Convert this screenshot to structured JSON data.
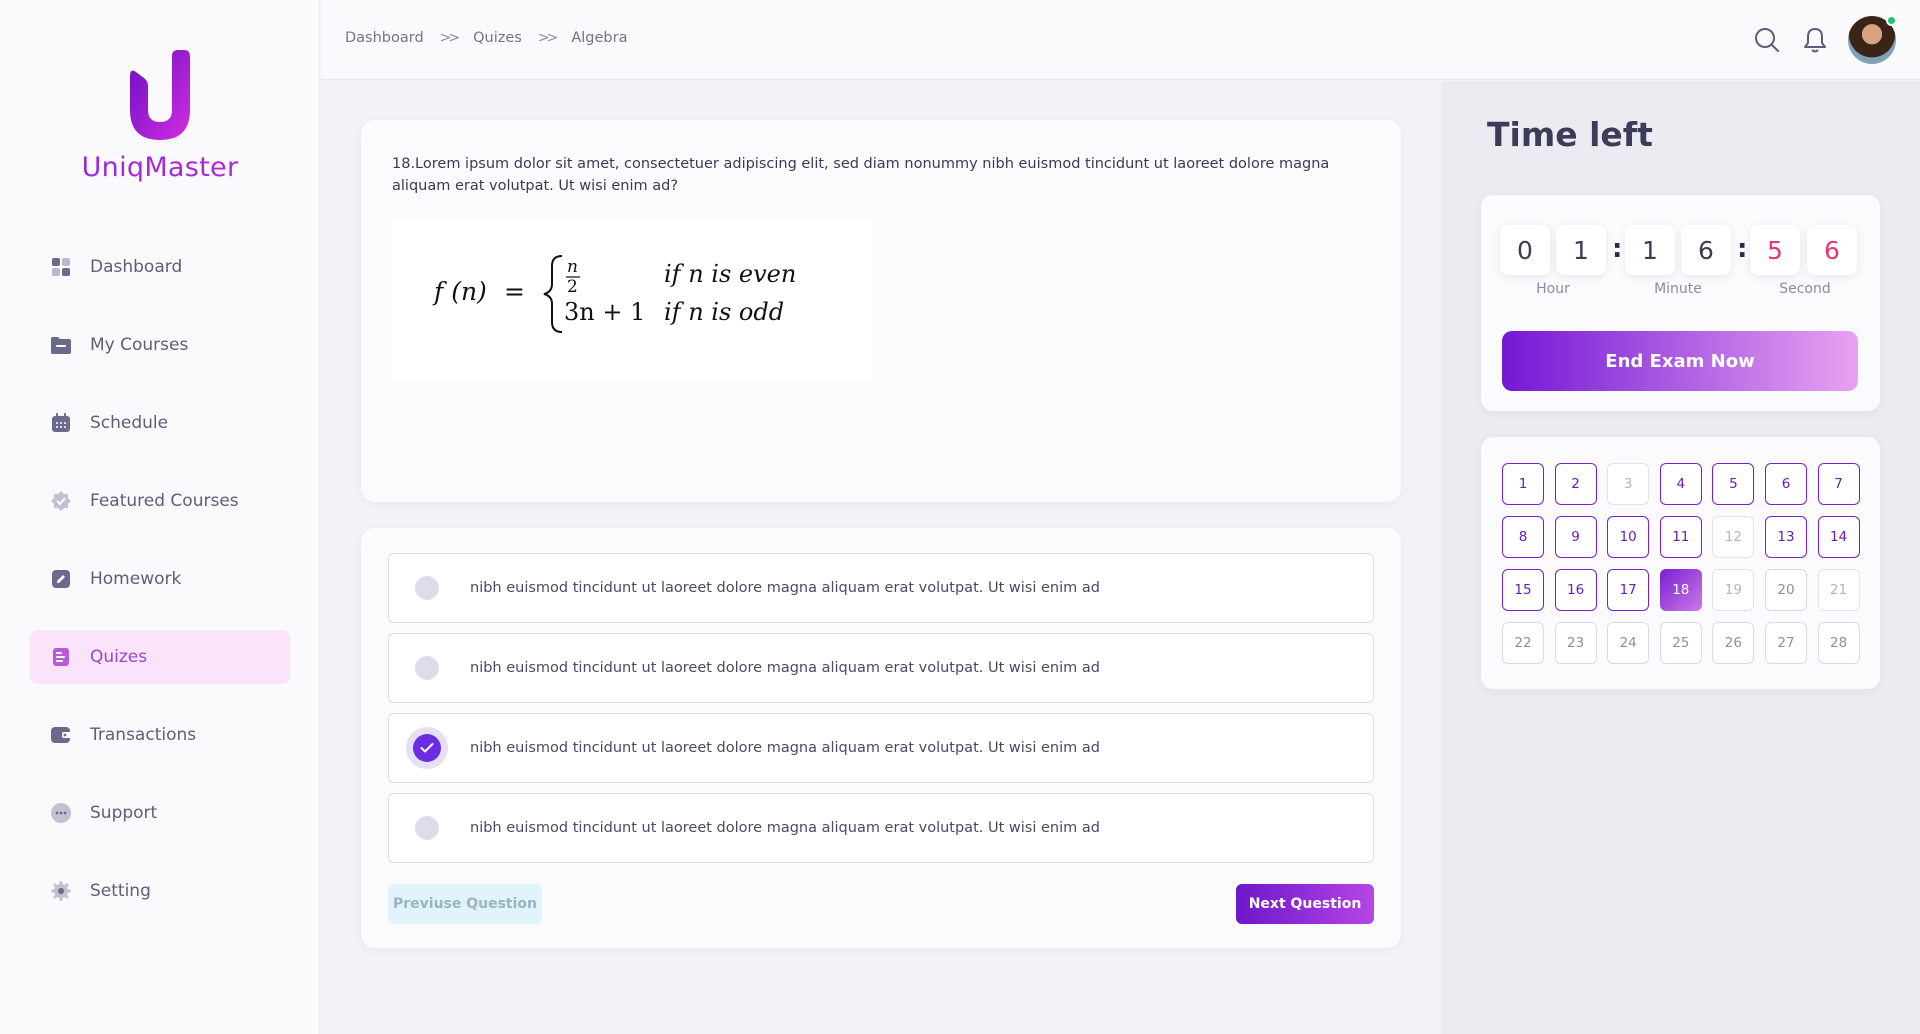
{
  "app": {
    "name": "UniqMaster"
  },
  "sidebar": {
    "items": [
      {
        "label": "Dashboard",
        "icon": "dashboard-icon",
        "active": false
      },
      {
        "label": "My Courses",
        "icon": "folder-icon",
        "active": false
      },
      {
        "label": "Schedule",
        "icon": "calendar-icon",
        "active": false
      },
      {
        "label": "Featured Courses",
        "icon": "badge-icon",
        "active": false
      },
      {
        "label": "Homework",
        "icon": "edit-icon",
        "active": false
      },
      {
        "label": "Quizes",
        "icon": "document-icon",
        "active": true
      },
      {
        "label": "Transactions",
        "icon": "wallet-icon",
        "active": false
      },
      {
        "label": "Support",
        "icon": "chat-icon",
        "active": false
      },
      {
        "label": "Setting",
        "icon": "gear-icon",
        "active": false
      }
    ]
  },
  "breadcrumb": [
    "Dashboard",
    "Quizes",
    "Algebra"
  ],
  "header": {
    "icons": [
      "search-icon",
      "bell-icon"
    ],
    "online_status_color": "#1ec77a"
  },
  "question": {
    "text": "18.Lorem ipsum dolor sit amet, consectetuer adipiscing elit, sed diam nonummy nibh euismod tincidunt ut laoreet dolore magna aliquam erat volutpat. Ut wisi enim ad?",
    "formula": {
      "lhs": "f (n)",
      "eq": "=",
      "case1_value_num": "n",
      "case1_value_den": "2",
      "case1_condition": "if n is even",
      "case2_value": "3n + 1",
      "case2_condition": "if n is odd"
    }
  },
  "answers": [
    {
      "text": "nibh euismod tincidunt ut laoreet dolore magna aliquam erat volutpat. Ut wisi enim ad",
      "selected": false
    },
    {
      "text": "nibh euismod tincidunt ut laoreet dolore magna aliquam erat volutpat. Ut wisi enim ad",
      "selected": false
    },
    {
      "text": "nibh euismod tincidunt ut laoreet dolore magna aliquam erat volutpat. Ut wisi enim ad",
      "selected": true
    },
    {
      "text": "nibh euismod tincidunt ut laoreet dolore magna aliquam erat volutpat. Ut wisi enim ad",
      "selected": false
    }
  ],
  "nav_buttons": {
    "prev": "Previuse Question",
    "next": "Next Question"
  },
  "timer": {
    "title": "Time left",
    "digits": [
      "0",
      "1",
      "1",
      "6",
      "5",
      "6"
    ],
    "labels": {
      "hour": "Hour",
      "minute": "Minute",
      "second": "Second"
    },
    "end_button": "End Exam Now"
  },
  "question_grid": [
    {
      "n": "1",
      "state": "answered"
    },
    {
      "n": "2",
      "state": "answered"
    },
    {
      "n": "3",
      "state": "skipped"
    },
    {
      "n": "4",
      "state": "answered"
    },
    {
      "n": "5",
      "state": "answered"
    },
    {
      "n": "6",
      "state": "answered"
    },
    {
      "n": "7",
      "state": "answered"
    },
    {
      "n": "8",
      "state": "answered"
    },
    {
      "n": "9",
      "state": "answered"
    },
    {
      "n": "10",
      "state": "answered"
    },
    {
      "n": "11",
      "state": "answered"
    },
    {
      "n": "12",
      "state": "skipped"
    },
    {
      "n": "13",
      "state": "answered"
    },
    {
      "n": "14",
      "state": "answered"
    },
    {
      "n": "15",
      "state": "answered"
    },
    {
      "n": "16",
      "state": "answered"
    },
    {
      "n": "17",
      "state": "answered"
    },
    {
      "n": "18",
      "state": "current"
    },
    {
      "n": "19",
      "state": "skipped"
    },
    {
      "n": "20",
      "state": "pending"
    },
    {
      "n": "21",
      "state": "skipped"
    },
    {
      "n": "22",
      "state": "pending"
    },
    {
      "n": "23",
      "state": "pending"
    },
    {
      "n": "24",
      "state": "pending"
    },
    {
      "n": "25",
      "state": "pending"
    },
    {
      "n": "26",
      "state": "pending"
    },
    {
      "n": "27",
      "state": "pending"
    },
    {
      "n": "28",
      "state": "pending"
    }
  ]
}
